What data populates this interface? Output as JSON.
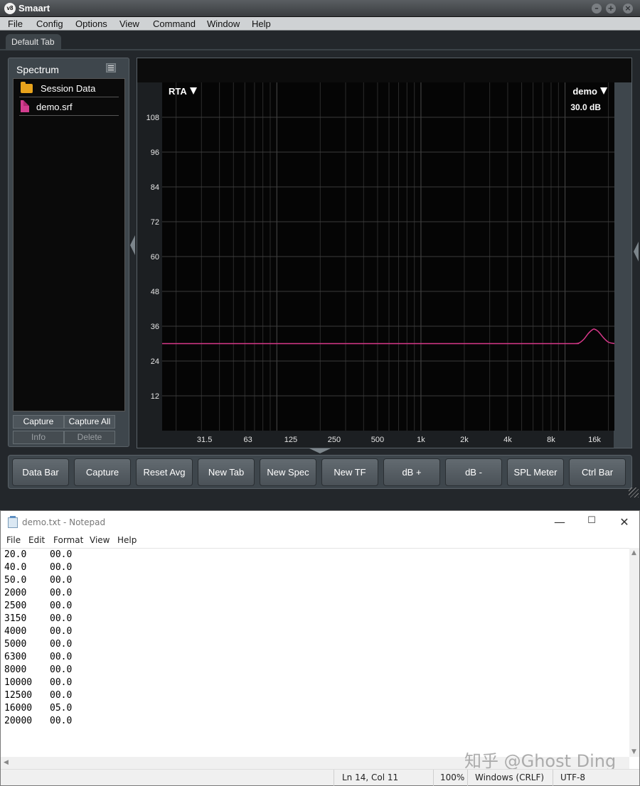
{
  "smaart": {
    "logo": "v8",
    "title": "Smaart",
    "menu": [
      "File",
      "Config",
      "Options",
      "View",
      "Command",
      "Window",
      "Help"
    ],
    "tab": "Default Tab",
    "panel": {
      "title": "Spectrum",
      "tree": [
        {
          "label": "Session Data",
          "icon": "folder-icon"
        },
        {
          "label": "demo.srf",
          "icon": "file-icon"
        }
      ],
      "buttons": {
        "capture": "Capture",
        "capture_all": "Capture All",
        "info": "Info",
        "delete": "Delete"
      }
    },
    "control_bar": [
      "Data Bar",
      "Capture",
      "Reset Avg",
      "New Tab",
      "New Spec",
      "New TF",
      "dB +",
      "dB -",
      "SPL Meter",
      "Ctrl Bar"
    ]
  },
  "chart_data": {
    "type": "line",
    "mode_label": "RTA",
    "trace_label": "demo",
    "trace_level": "30.0 dB",
    "y_ticks": [
      108,
      96,
      84,
      72,
      60,
      48,
      36,
      24,
      12
    ],
    "ylim": [
      0,
      120
    ],
    "x_ticks": [
      "31.5",
      "63",
      "125",
      "250",
      "500",
      "1k",
      "2k",
      "4k",
      "8k",
      "16k"
    ],
    "x_scale": "log",
    "xlim": [
      16,
      22000
    ],
    "grid": true,
    "trace_color": "#d8388a",
    "series": [
      {
        "name": "demo",
        "x": [
          16,
          100,
          1000,
          10000,
          11500,
          12500,
          13500,
          14500,
          15500,
          16000,
          17000,
          18500,
          20000,
          22000
        ],
        "y": [
          30,
          30,
          30,
          30,
          30,
          30.2,
          31.5,
          33.5,
          34.8,
          35,
          34.2,
          32,
          30.5,
          30
        ]
      }
    ]
  },
  "notepad": {
    "title": "demo.txt - Notepad",
    "menu": [
      "File",
      "Edit",
      "Format",
      "View",
      "Help"
    ],
    "lines": [
      [
        "20.0",
        "00.0"
      ],
      [
        "40.0",
        "00.0"
      ],
      [
        "50.0",
        "00.0"
      ],
      [
        "2000",
        "00.0"
      ],
      [
        "2500",
        "00.0"
      ],
      [
        "3150",
        "00.0"
      ],
      [
        "4000",
        "00.0"
      ],
      [
        "5000",
        "00.0"
      ],
      [
        "6300",
        "00.0"
      ],
      [
        "8000",
        "00.0"
      ],
      [
        "10000",
        "00.0"
      ],
      [
        "12500",
        "00.0"
      ],
      [
        "16000",
        "05.0"
      ],
      [
        "20000",
        "00.0"
      ]
    ],
    "status": {
      "position": "Ln 14, Col 11",
      "zoom": "100%",
      "line_ending": "Windows (CRLF)",
      "encoding": "UTF-8"
    },
    "watermark": "知乎 @Ghost Ding"
  }
}
